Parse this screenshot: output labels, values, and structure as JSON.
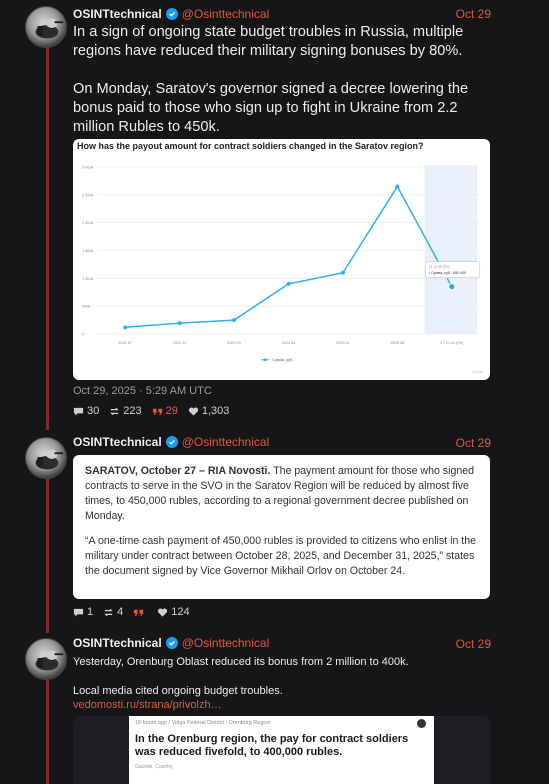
{
  "posts": [
    {
      "name": "OSINTtechnical",
      "handle": "@Osinttechnical",
      "date": "Oct 29",
      "text1": "In a sign of ongoing state budget troubles in Russia, multiple regions have reduced their military signing bonuses by 80%.",
      "text2": "On Monday, Saratov's governor signed a decree lowering the bonus paid to those who sign up to fight in Ukraine from 2.2 million Rubles to 450k.",
      "timestamp": "Oct 29, 2025 · 5:29 AM UTC",
      "stats": {
        "replies": "30",
        "reposts": "223",
        "quotes": "29",
        "likes": "1,303"
      }
    },
    {
      "name": "OSINTtechnical",
      "handle": "@Osinttechnical",
      "date": "Oct 29",
      "quote_lead": "SARATOV, October 27 – RIA Novosti.",
      "quote_p1": "The payment amount for those who signed contracts to serve in the SVO in the Saratov Region will be reduced by almost five times, to 450,000 rubles, according to a regional government decree published on Monday.",
      "quote_p2": "“A one-time cash payment of 450,000 rubles is provided to citizens who enlist in the military under contract between October 28, 2025, and December 31, 2025,” states the document signed by Vice Governor Mikhail Orlov on October 24.",
      "stats": {
        "replies": "1",
        "reposts": "4",
        "quotes": "",
        "likes": "124"
      }
    },
    {
      "name": "OSINTtechnical",
      "handle": "@Osinttechnical",
      "date": "Oct 29",
      "text1": "Yesterday, Orenburg Oblast reduced its bonus from 2 million to 400k.",
      "text2": "Local media cited ongoing budget troubles.",
      "link": "vedomosti.ru/strana/privolzh…",
      "preview": {
        "meta": "16 hours ago / Volga Federal District / Orenburg Region",
        "headline": "In the Orenburg region, the pay for contract soldiers was reduced fivefold, to 400,000 rubles.",
        "byline": "Gazette, Country"
      }
    }
  ],
  "chart_data": {
    "type": "line",
    "title": "How has the payout amount for contract soldiers changed in the Saratov region?",
    "categories": [
      "2022.07",
      "2022.11",
      "2023.01",
      "2024.06",
      "2025.01",
      "2025.08",
      "27.10.25 (Пл)"
    ],
    "series": [
      {
        "name": "Сумма, руб.",
        "values": [
          120000,
          195000,
          250000,
          900000,
          1100000,
          2650000,
          850000
        ]
      }
    ],
    "yticks": [
      "0",
      "500k",
      "1 000k",
      "1 500k",
      "2 000k",
      "2 500k",
      "3 000k"
    ],
    "ylim": [
      0,
      3000000
    ],
    "tooltip": {
      "date": "27.10.25 (Пл)",
      "label": "• Сумма, руб.: 850 000"
    },
    "legend": "Сумма, руб.",
    "source": "Flourish",
    "colors": {
      "line": "#33aee8",
      "highlight": "#eaf0fb"
    }
  }
}
